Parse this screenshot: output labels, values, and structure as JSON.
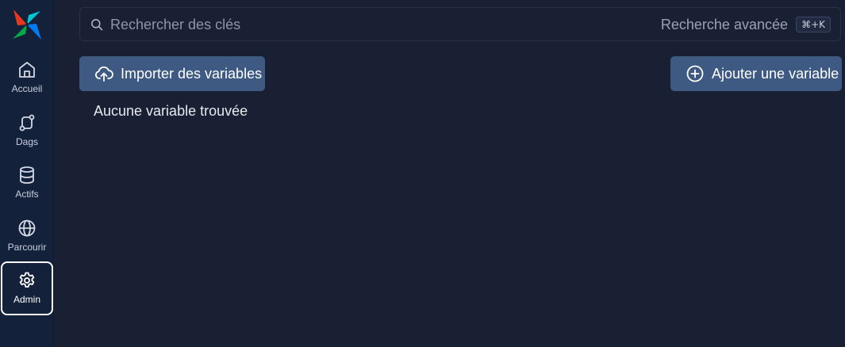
{
  "sidebar": {
    "items": [
      {
        "label": "Accueil",
        "icon": "home-icon"
      },
      {
        "label": "Dags",
        "icon": "dag-icon"
      },
      {
        "label": "Actifs",
        "icon": "database-icon"
      },
      {
        "label": "Parcourir",
        "icon": "globe-icon"
      },
      {
        "label": "Admin",
        "icon": "gear-icon",
        "active": true
      }
    ]
  },
  "search": {
    "placeholder": "Rechercher des clés",
    "value": "",
    "advanced_label": "Recherche avancée",
    "shortcut": "⌘+K"
  },
  "toolbar": {
    "import_label": "Importer des variables",
    "add_label": "Ajouter une variable"
  },
  "main": {
    "empty_message": "Aucune variable trouvée"
  },
  "colors": {
    "background": "#1a2033",
    "sidebar": "#14213a",
    "button": "#3f5a82"
  }
}
